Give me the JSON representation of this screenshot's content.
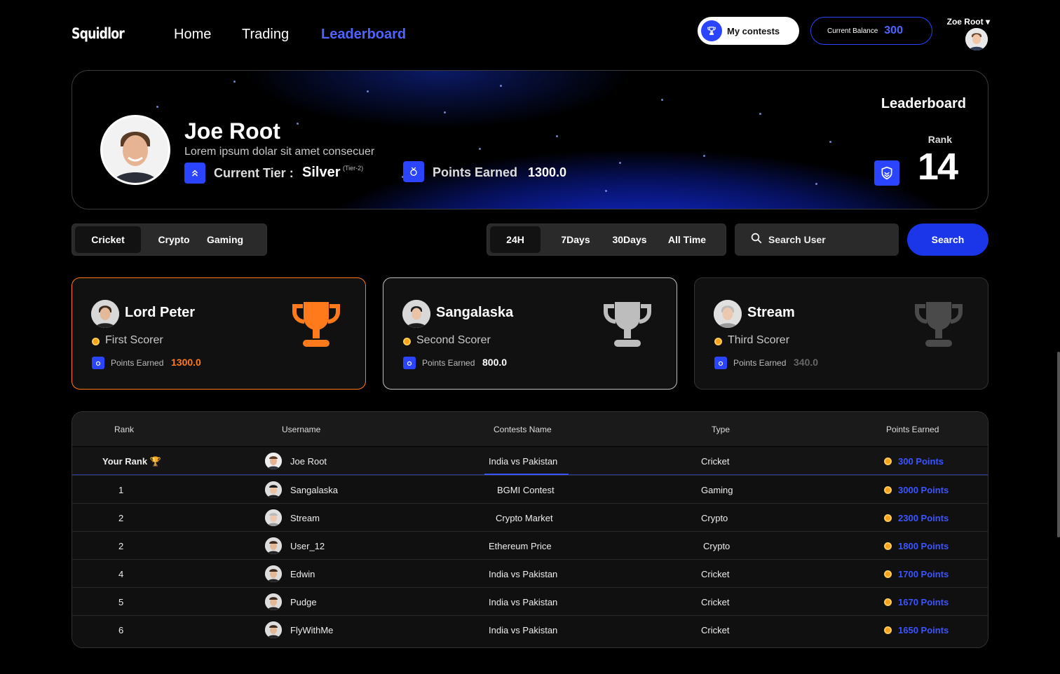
{
  "nav": {
    "logo": "Squidlor",
    "links": [
      "Home",
      "Trading",
      "Leaderboard"
    ],
    "active": "Leaderboard",
    "contests_label": "My contests",
    "balance_label": "Current Balance",
    "balance_value": "300",
    "user_name": "Zoe Root ▾"
  },
  "hero": {
    "name": "Joe Root",
    "subtitle": "Lorem ipsum dolar sit amet consecuer",
    "tier_label": "Current Tier :",
    "tier_value": "Silver",
    "tier_sup": "(Tier-2)",
    "points_label": "Points Earned",
    "points_value": "1300.0",
    "title": "Leaderboard",
    "rank_label": "Rank",
    "rank_value": "14"
  },
  "filters": {
    "categories": [
      "Cricket",
      "Crypto",
      "Gaming"
    ],
    "selected_category": "Cricket",
    "periods": [
      "24H",
      "7Days",
      "30Days",
      "All Time"
    ],
    "selected_period": "24H",
    "search_placeholder": "Search User",
    "search_button": "Search"
  },
  "top_cards": [
    {
      "name": "Lord Peter",
      "role": "First Scorer",
      "points_label": "Points Earned",
      "points": "1300.0",
      "accent": "#ff7a1a"
    },
    {
      "name": "Sangalaska",
      "role": "Second Scorer",
      "points_label": "Points Earned",
      "points": "800.0",
      "accent": "#bfbfbf"
    },
    {
      "name": "Stream",
      "role": "Third Scorer",
      "points_label": "Points Earned",
      "points": "340.0",
      "accent": "#555555"
    }
  ],
  "table": {
    "headers": [
      "Rank",
      "Username",
      "Contests Name",
      "Type",
      "Points Earned"
    ],
    "your_rank": {
      "rank": "Your Rank 🏆",
      "username": "Joe Root",
      "contest": "India vs Pakistan",
      "type": "Cricket",
      "points": "300 Points"
    },
    "rows": [
      {
        "rank": "1",
        "username": "Sangalaska",
        "contest": "BGMI Contest",
        "type": "Gaming",
        "points": "3000 Points"
      },
      {
        "rank": "2",
        "username": "Stream",
        "contest": "Crypto Market",
        "type": "Crypto",
        "points": "2300 Points"
      },
      {
        "rank": "2",
        "username": "User_12",
        "contest": "Ethereum Price",
        "type": "Crypto",
        "points": "1800 Points"
      },
      {
        "rank": "4",
        "username": "Edwin",
        "contest": "India vs Pakistan",
        "type": "Cricket",
        "points": "1700 Points"
      },
      {
        "rank": "5",
        "username": "Pudge",
        "contest": "India vs Pakistan",
        "type": "Cricket",
        "points": "1670 Points"
      },
      {
        "rank": "6",
        "username": "FlyWithMe",
        "contest": "India vs Pakistan",
        "type": "Cricket",
        "points": "1650 Points"
      }
    ]
  },
  "colors": {
    "accent_blue": "#2b44ff",
    "link_blue": "#4f64ff",
    "gold": "#f7a21b"
  }
}
